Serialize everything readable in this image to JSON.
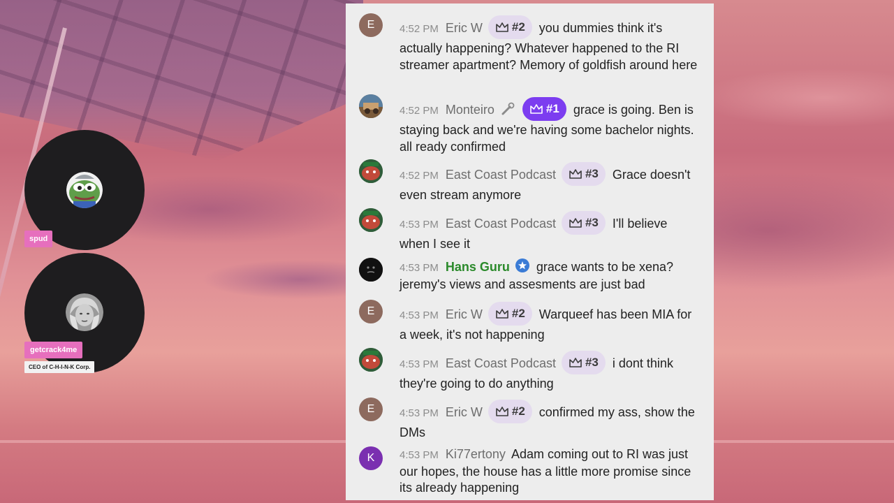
{
  "colors": {
    "panel_bg": "#ededed",
    "badge_bg": "#e4dbee",
    "badge_top_bg": "#7c3df0",
    "tag_pink": "#e66fbd",
    "green_name": "#2b8a2b"
  },
  "voice": [
    {
      "name": "spud",
      "icon": "pepe-avatar-icon"
    },
    {
      "name": "getcrack4me",
      "subtitle": "CEO of C-H-I-N-K Corp.",
      "icon": "portrait-avatar-icon"
    }
  ],
  "messages": [
    {
      "avatar": "E",
      "time": "4:52 PM",
      "user": "Eric W",
      "badge": "#2",
      "text": "you dummies think it's actually happening? Whatever happened to the RI streamer apartment? Memory of goldfish around here"
    },
    {
      "avatar": "",
      "time": "4:52 PM",
      "user": "Monteiro",
      "badge": "#1",
      "text": "grace is going. Ben is staying back and we're having some bachelor nights. all ready confirmed"
    },
    {
      "avatar": "",
      "time": "4:52 PM",
      "user": "East Coast Podcast",
      "badge": "#3",
      "text": "Grace doesn't even stream anymore"
    },
    {
      "avatar": "",
      "time": "4:53 PM",
      "user": "East Coast Podcast",
      "badge": "#3",
      "text": "I'll believe when I see it"
    },
    {
      "avatar": "",
      "time": "4:53 PM",
      "user": "Hans Guru",
      "badge": "",
      "text": "grace wants to be xena? jeremy's views and assesments are just bad"
    },
    {
      "avatar": "E",
      "time": "4:53 PM",
      "user": "Eric W",
      "badge": "#2",
      "text": "Warqueef has been MIA for a week, it's not happening"
    },
    {
      "avatar": "",
      "time": "4:53 PM",
      "user": "East Coast Podcast",
      "badge": "#3",
      "text": "i dont think they're going to do anything"
    },
    {
      "avatar": "E",
      "time": "4:53 PM",
      "user": "Eric W",
      "badge": "#2",
      "text": "confirmed my ass, show the DMs"
    },
    {
      "avatar": "K",
      "time": "4:53 PM",
      "user": "Ki77ertony",
      "badge": "",
      "text": "Adam coming out to RI was just our hopes, the house has a little more promise since its already happening"
    }
  ]
}
